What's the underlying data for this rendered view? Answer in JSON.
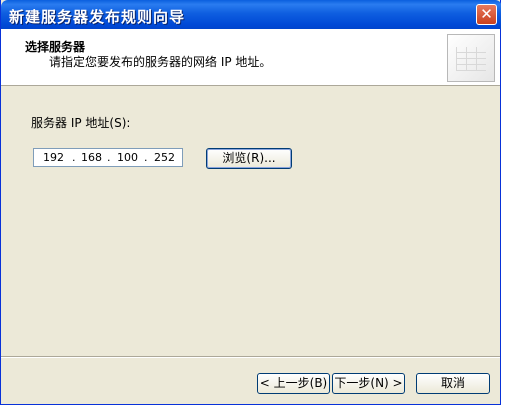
{
  "window": {
    "title": "新建服务器发布规则向导",
    "close_symbol": "✕"
  },
  "header": {
    "title": "选择服务器",
    "subtitle": "请指定您要发布的服务器的网络 IP 地址。"
  },
  "form": {
    "ip_label": "服务器 IP 地址(S):",
    "ip": {
      "o1": "192",
      "o2": "168",
      "o3": "100",
      "o4": "252",
      "dot": "."
    },
    "browse_label": "浏览(R)..."
  },
  "footer": {
    "back_label": "< 上一步(B)",
    "next_label": "下一步(N) >",
    "cancel_label": "取消"
  }
}
